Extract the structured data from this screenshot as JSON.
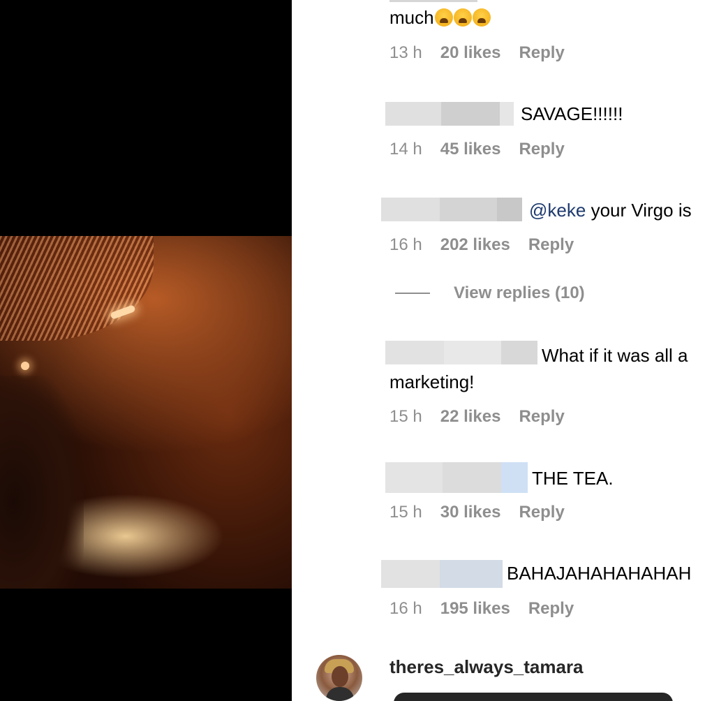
{
  "comments": [
    {
      "text_tail": "much",
      "emoji": [
        "loudly-crying-face-emoji",
        "loudly-crying-face-emoji",
        "loudly-crying-face-emoji"
      ],
      "time": "13 h",
      "likes": "20 likes",
      "reply": "Reply"
    },
    {
      "text": "SAVAGE!!!!!!",
      "time": "14 h",
      "likes": "45 likes",
      "reply": "Reply"
    },
    {
      "mention": "@keke",
      "text": "your Virgo is",
      "time": "16 h",
      "likes": "202 likes",
      "reply": "Reply"
    },
    {
      "text_line1": "What if it was all a",
      "text_line2": "marketing!",
      "time": "15 h",
      "likes": "22 likes",
      "reply": "Reply"
    },
    {
      "text": "THE TEA.",
      "time": "15 h",
      "likes": "30 likes",
      "reply": "Reply"
    },
    {
      "text": "BAHAJAHAHAHAHAH",
      "time": "16 h",
      "likes": "195 likes",
      "reply": "Reply"
    }
  ],
  "view_replies": "View replies (10)",
  "last_user": {
    "username": "theres_always_tamara",
    "avatar_icon": "profile-avatar"
  },
  "colors": {
    "meta_gray": "#8e8e8e",
    "mention_blue": "#1e3a6e",
    "media_bg": "#000000"
  }
}
